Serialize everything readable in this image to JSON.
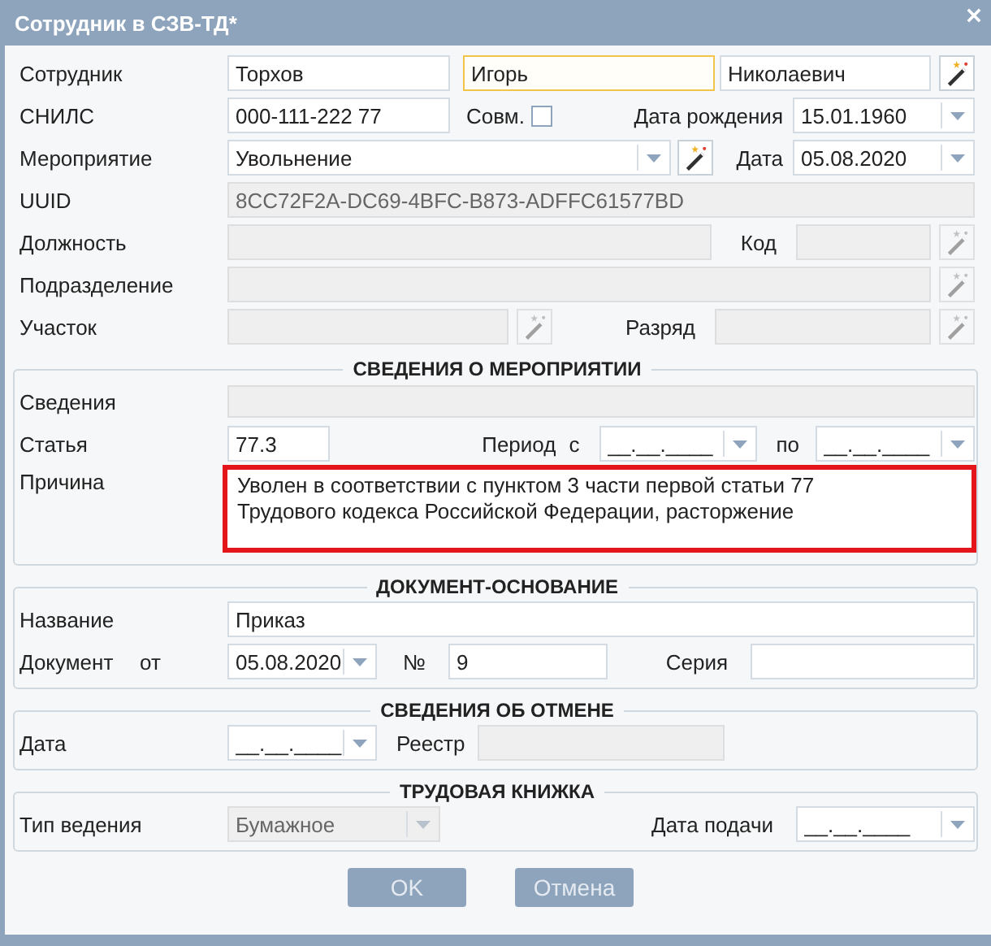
{
  "window": {
    "title": "Сотрудник в СЗВ-ТД*"
  },
  "employee": {
    "label": "Сотрудник",
    "fields": [
      {
        "value": "Торхов",
        "focused": false
      },
      {
        "value": "Игорь",
        "focused": true
      },
      {
        "value": "Николаевич",
        "focused": false
      }
    ],
    "picker": {
      "disabled": false
    }
  },
  "snils": {
    "label": "СНИЛС",
    "value": "000-111-222 77"
  },
  "combined": {
    "label": "Совм.",
    "checked": false
  },
  "birth_date": {
    "label": "Дата рождения",
    "value": "15.01.1960"
  },
  "event": {
    "label": "Мероприятие",
    "value": "Увольнение",
    "picker": {
      "disabled": false
    }
  },
  "event_date": {
    "label": "Дата",
    "value": "05.08.2020"
  },
  "uuid": {
    "label": "UUID",
    "value": "8CC72F2A-DC69-4BFC-B873-ADFFC61577BD",
    "disabled": true
  },
  "position": {
    "label": "Должность",
    "disabled": true
  },
  "code": {
    "label": "Код",
    "disabled": true,
    "picker": {
      "disabled": true
    }
  },
  "department": {
    "label": "Подразделение",
    "disabled": true,
    "picker": {
      "disabled": true
    }
  },
  "site": {
    "label": "Участок",
    "disabled": true,
    "picker": {
      "disabled": true
    }
  },
  "grade": {
    "label": "Разряд",
    "disabled": true,
    "picker": {
      "disabled": true
    }
  },
  "event_info": {
    "title": "СВЕДЕНИЯ О МЕРОПРИЯТИИ",
    "details": {
      "label": "Сведения",
      "disabled": true
    },
    "article": {
      "label": "Статья",
      "value": "77.3"
    },
    "period": {
      "label": "Период",
      "from": {
        "label": "с",
        "value": "__.__.____"
      },
      "to": {
        "label": "по",
        "value": "__.__.____"
      }
    },
    "reason": {
      "label": "Причина",
      "value": "Уволен в соответствии с пунктом 3 части первой статьи 77 Трудового кодекса Российской Федерации, расторжение",
      "error": true
    }
  },
  "basis_document": {
    "title": "ДОКУМЕНТ-ОСНОВАНИЕ",
    "name": {
      "label": "Название",
      "value": "Приказ"
    },
    "document": {
      "label": "Документ",
      "date": {
        "label": "от",
        "value": "05.08.2020"
      },
      "number": {
        "label": "№",
        "value": "9"
      },
      "series": {
        "label": "Серия"
      }
    }
  },
  "cancellation": {
    "title": "СВЕДЕНИЯ ОБ ОТМЕНЕ",
    "date": {
      "label": "Дата",
      "value": "__.__.____"
    },
    "registry": {
      "label": "Реестр",
      "disabled": true
    }
  },
  "work_book": {
    "title": "ТРУДОВАЯ КНИЖКА",
    "type": {
      "label": "Тип ведения",
      "value": "Бумажное",
      "disabled": true
    },
    "submit_date": {
      "label": "Дата подачи",
      "value": "__.__.____"
    }
  },
  "buttons": [
    {
      "label": "OK"
    },
    {
      "label": "Отмена"
    }
  ]
}
